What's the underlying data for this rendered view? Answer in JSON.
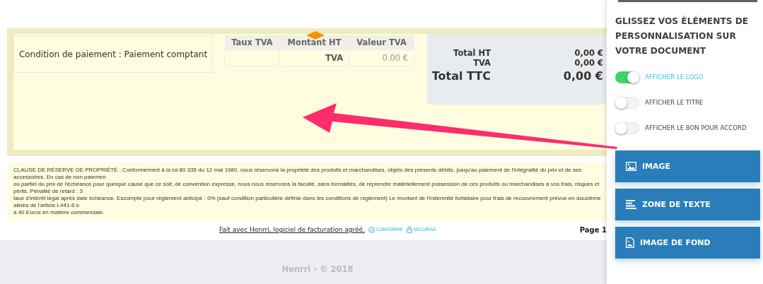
{
  "payment_condition": "Condition de paiement : Paiement comptant",
  "tax_table": {
    "columns": [
      "Taux TVA",
      "Montant HT",
      "Valeur TVA"
    ],
    "rows": [
      [
        "",
        "TVA",
        "0.00 €"
      ]
    ]
  },
  "totals": [
    {
      "label": "Total HT",
      "value": "0,00 €",
      "kind": "normal"
    },
    {
      "label": "TVA",
      "value": "0,00 €",
      "kind": "normal"
    },
    {
      "label": "Total TTC",
      "value": "0,00 €",
      "kind": "grand"
    }
  ],
  "legal_text": [
    "CLAUSE DE RÉSERVE DE PROPRIÉTÉ : Conformément à la loi 80.335 du 12 mai 1980, nous réservons la propriété des produits et marchandises, objets des présents débits, jusqu'au paiement de l'intégralité du prix et de ses accessoires. En cas de non paiemen",
    "ou partiel du prix de l'échéance pour quelque cause que ce soit, de convention expresse, nous nous réservons la faculté, sans formalités, de reprendre matériellement possession de ces produits ou marchandises à vos frais, risques et périls. Pénalité de retard : 3",
    "taux d'intérêt légal après date échéance. Escompte pour règlement anticipé : 0% (sauf condition particulière définie dans les conditions de règlement) Le montant de l'indemnité forfaitaire pour frais de recouvrement prévue en douzième alinéa de l'article L441-6 e",
    "à 40 Euros en matière commerciale."
  ],
  "footer": {
    "link": "Fait avec Henrri, logiciel de facturation agréé.",
    "badges": [
      {
        "label": "CONFORME",
        "kind": "check"
      },
      {
        "label": "SÉCURISÉ",
        "kind": "lock"
      }
    ],
    "page": "Page 1"
  },
  "copyright": "Henrri - © 2018",
  "panel": {
    "heading": "GLISSEZ VOS ÉLÉMENTS DE PERSONNALISATION SUR VOTRE DOCUMENT",
    "toggles": [
      {
        "label": "AFFICHER LE LOGO",
        "on": true
      },
      {
        "label": "AFFICHER LE TITRE",
        "on": false
      },
      {
        "label": "AFFICHER LE BON POUR ACCORD",
        "on": false
      }
    ],
    "buttons": [
      {
        "label": "IMAGE",
        "kind": "image"
      },
      {
        "label": "ZONE DE TEXTE",
        "kind": "text"
      },
      {
        "label": "IMAGE DE FOND",
        "kind": "background"
      }
    ]
  }
}
